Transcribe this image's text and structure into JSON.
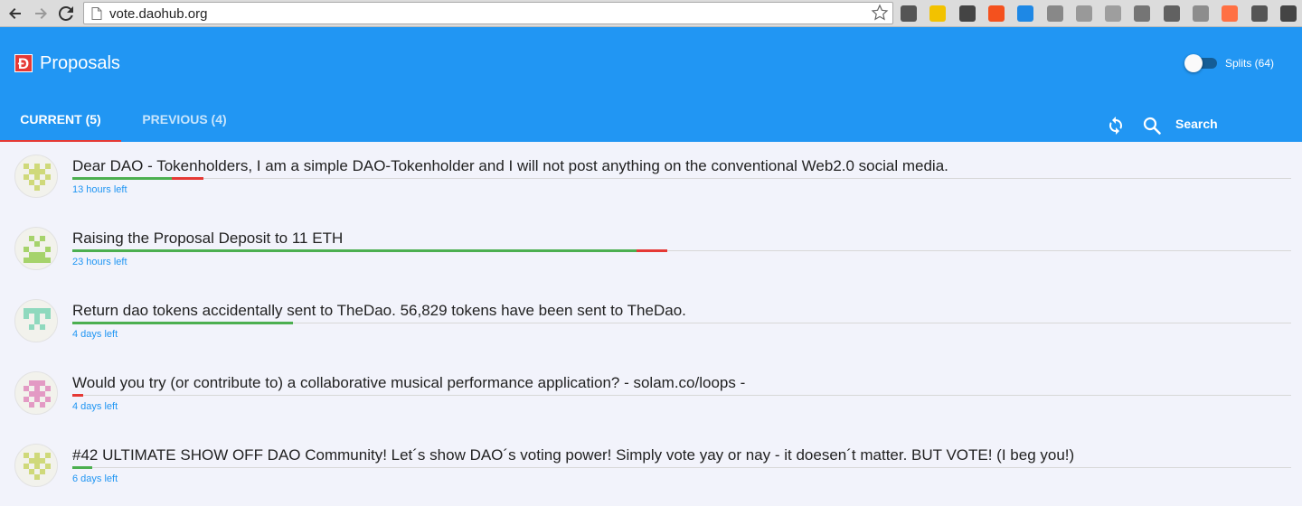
{
  "browser": {
    "url": "vote.daohub.org",
    "extensions": [
      {
        "name": "ext-1-icon",
        "color": "#555555"
      },
      {
        "name": "ext-2-icon",
        "color": "#f2c200"
      },
      {
        "name": "ext-3-icon",
        "color": "#444444"
      },
      {
        "name": "ext-4-icon",
        "color": "#f4511e"
      },
      {
        "name": "ext-5-icon",
        "color": "#1e88e5"
      },
      {
        "name": "ext-6-icon",
        "color": "#888888"
      },
      {
        "name": "ext-7-icon",
        "color": "#999999"
      },
      {
        "name": "ext-8-icon",
        "color": "#9e9e9e"
      },
      {
        "name": "ext-9-icon",
        "color": "#757575"
      },
      {
        "name": "ext-10-icon",
        "color": "#616161"
      },
      {
        "name": "ext-11-icon",
        "color": "#8d8d8d"
      },
      {
        "name": "ext-12-icon",
        "color": "#ff7043"
      },
      {
        "name": "ext-13-icon",
        "color": "#555555"
      },
      {
        "name": "ext-14-icon",
        "color": "#444444"
      }
    ]
  },
  "header": {
    "logo": "Đ",
    "title": "Proposals",
    "splits_label": "Splits (64)",
    "splits_on": false,
    "accent": "#2196f3",
    "ink": "#e53935"
  },
  "tabs": {
    "current": "CURRENT (5)",
    "previous": "PREVIOUS (4)",
    "active": "current"
  },
  "toolbar": {
    "refresh_icon": "refresh-icon",
    "search_icon": "search-icon",
    "search_label": "Search"
  },
  "proposals": [
    {
      "title": "Dear DAO - Tokenholders, I am a simple DAO-Tokenholder and I will not post anything on the conventional Web2.0 social media.",
      "time_left": "13 hours left",
      "yes_ratio": 0.755,
      "no_ratio": 0.245,
      "avatar_color": "#cfd97a"
    },
    {
      "title": "Raising the Proposal Deposit to 11 ETH",
      "time_left": "23 hours left",
      "yes_ratio": 0.948,
      "no_ratio": 0.052,
      "avatar_color": "#a6d36b"
    },
    {
      "title": "Return dao tokens accidentally sent to TheDao. 56,829 tokens have been sent to TheDao.",
      "time_left": "4 days left",
      "yes_ratio": 1.0,
      "no_ratio": 0.0,
      "avatar_color": "#8fd9be"
    },
    {
      "title": "Would you try (or contribute to) a collaborative musical performance application? - solam.co/loops -",
      "time_left": "4 days left",
      "yes_ratio": 0.0,
      "no_ratio": 1.0,
      "avatar_color": "#e39ac4"
    },
    {
      "title": "#42 ULTIMATE SHOW OFF DAO Community! Let´s show DAO´s voting power! Simply vote yay or nay - it doesen´t matter. BUT VOTE! (I beg you!)",
      "time_left": "6 days left",
      "yes_ratio": 1.0,
      "no_ratio": 0.0,
      "avatar_color": "#cfd97a"
    }
  ]
}
